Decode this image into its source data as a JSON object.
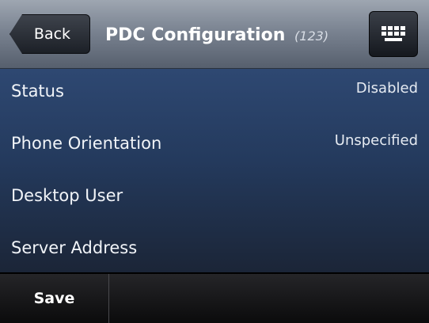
{
  "header": {
    "back_label": "Back",
    "title": "PDC Configuration",
    "count": "(123)",
    "keyboard_icon": "keyboard-icon"
  },
  "settings": [
    {
      "label": "Status",
      "value": "Disabled"
    },
    {
      "label": "Phone Orientation",
      "value": "Unspecified"
    },
    {
      "label": "Desktop User",
      "value": ""
    },
    {
      "label": "Server Address",
      "value": ""
    }
  ],
  "softkeys": [
    {
      "label": "Save"
    }
  ],
  "colors": {
    "list_bg": "#2e4872",
    "header_bg": "#7a8391",
    "footer_bg": "#111112"
  }
}
